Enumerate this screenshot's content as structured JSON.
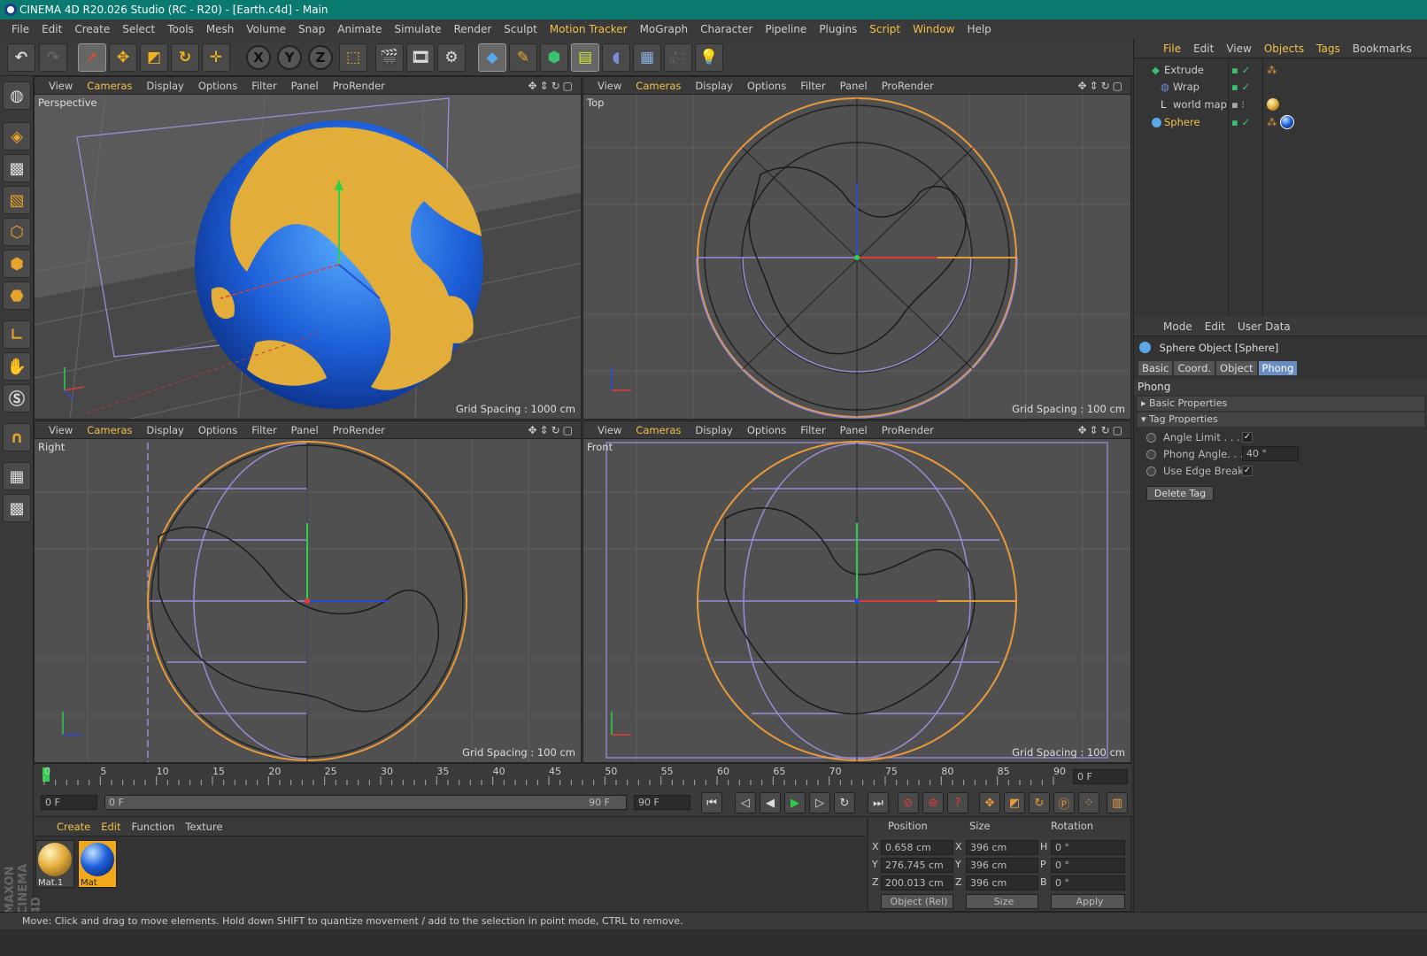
{
  "window": {
    "title": "CINEMA 4D R20.026 Studio (RC - R20) - [Earth.c4d] - Main"
  },
  "menu": [
    "File",
    "Edit",
    "Create",
    "Select",
    "Tools",
    "Mesh",
    "Volume",
    "Snap",
    "Animate",
    "Simulate",
    "Render",
    "Sculpt",
    "Motion Tracker",
    "MoGraph",
    "Character",
    "Pipeline",
    "Plugins",
    "Script",
    "Window",
    "Help"
  ],
  "viewport_menu": [
    "View",
    "Cameras",
    "Display",
    "Options",
    "Filter",
    "Panel",
    "ProRender"
  ],
  "viewports": {
    "perspective": {
      "label": "Perspective",
      "grid": "Grid Spacing : 1000 cm"
    },
    "top": {
      "label": "Top",
      "grid": "Grid Spacing : 100 cm"
    },
    "right": {
      "label": "Right",
      "grid": "Grid Spacing : 100 cm"
    },
    "front": {
      "label": "Front",
      "grid": "Grid Spacing : 100 cm"
    }
  },
  "toolbar": {
    "axis_x": "X",
    "axis_y": "Y",
    "axis_z": "Z"
  },
  "timeline": {
    "ticks": [
      "0",
      "5",
      "10",
      "15",
      "20",
      "25",
      "30",
      "35",
      "40",
      "45",
      "50",
      "55",
      "60",
      "65",
      "70",
      "75",
      "80",
      "85",
      "90"
    ],
    "current_frame": "0 F",
    "start_field": "0 F",
    "range_start": "0 F",
    "range_end": "90 F",
    "end_field": "90 F"
  },
  "materials": {
    "menu": [
      "Create",
      "Edit",
      "Function",
      "Texture"
    ],
    "items": [
      {
        "name": "Mat.1",
        "color": "#e3ad3a"
      },
      {
        "name": "Mat",
        "color": "#1d5fd8"
      }
    ]
  },
  "coords": {
    "headers": {
      "position": "Position",
      "size": "Size",
      "rotation": "Rotation"
    },
    "rows": [
      {
        "axis": "X",
        "pos": "0.658 cm",
        "saxis": "X",
        "size": "396 cm",
        "raxis": "H",
        "rot": "0 °"
      },
      {
        "axis": "Y",
        "pos": "276.745 cm",
        "saxis": "Y",
        "size": "396 cm",
        "raxis": "P",
        "rot": "0 °"
      },
      {
        "axis": "Z",
        "pos": "200.013 cm",
        "saxis": "Z",
        "size": "396 cm",
        "raxis": "B",
        "rot": "0 °"
      }
    ],
    "mode": "Object (Rel)",
    "size_mode": "Size",
    "apply": "Apply"
  },
  "objects": {
    "menu": [
      "File",
      "Edit",
      "View",
      "Objects",
      "Tags",
      "Bookmarks"
    ],
    "items": [
      "Extrude",
      "Wrap",
      "world map",
      "Sphere"
    ]
  },
  "attributes": {
    "menu": [
      "Mode",
      "Edit",
      "User Data"
    ],
    "title": "Sphere Object [Sphere]",
    "tabs": [
      "Basic",
      "Coord.",
      "Object",
      "Phong"
    ],
    "section": "Phong",
    "groups": [
      "Basic Properties",
      "Tag Properties"
    ],
    "props": {
      "angle_limit": "Angle Limit . . . . .",
      "phong_angle": "Phong Angle. . . .",
      "phong_value": "40 °",
      "edge_breaks": "Use Edge Breaks"
    },
    "delete_tag": "Delete Tag"
  },
  "status": "Move: Click and drag to move elements. Hold down SHIFT to quantize movement / add to the selection in point mode, CTRL to remove.",
  "brand": "MAXON CINEMA 4D",
  "colors": {
    "accent": "#f2c14a",
    "titlebar": "#0a7a70",
    "globe_blue": "#1d5fd8",
    "land": "#e3ad3a"
  }
}
